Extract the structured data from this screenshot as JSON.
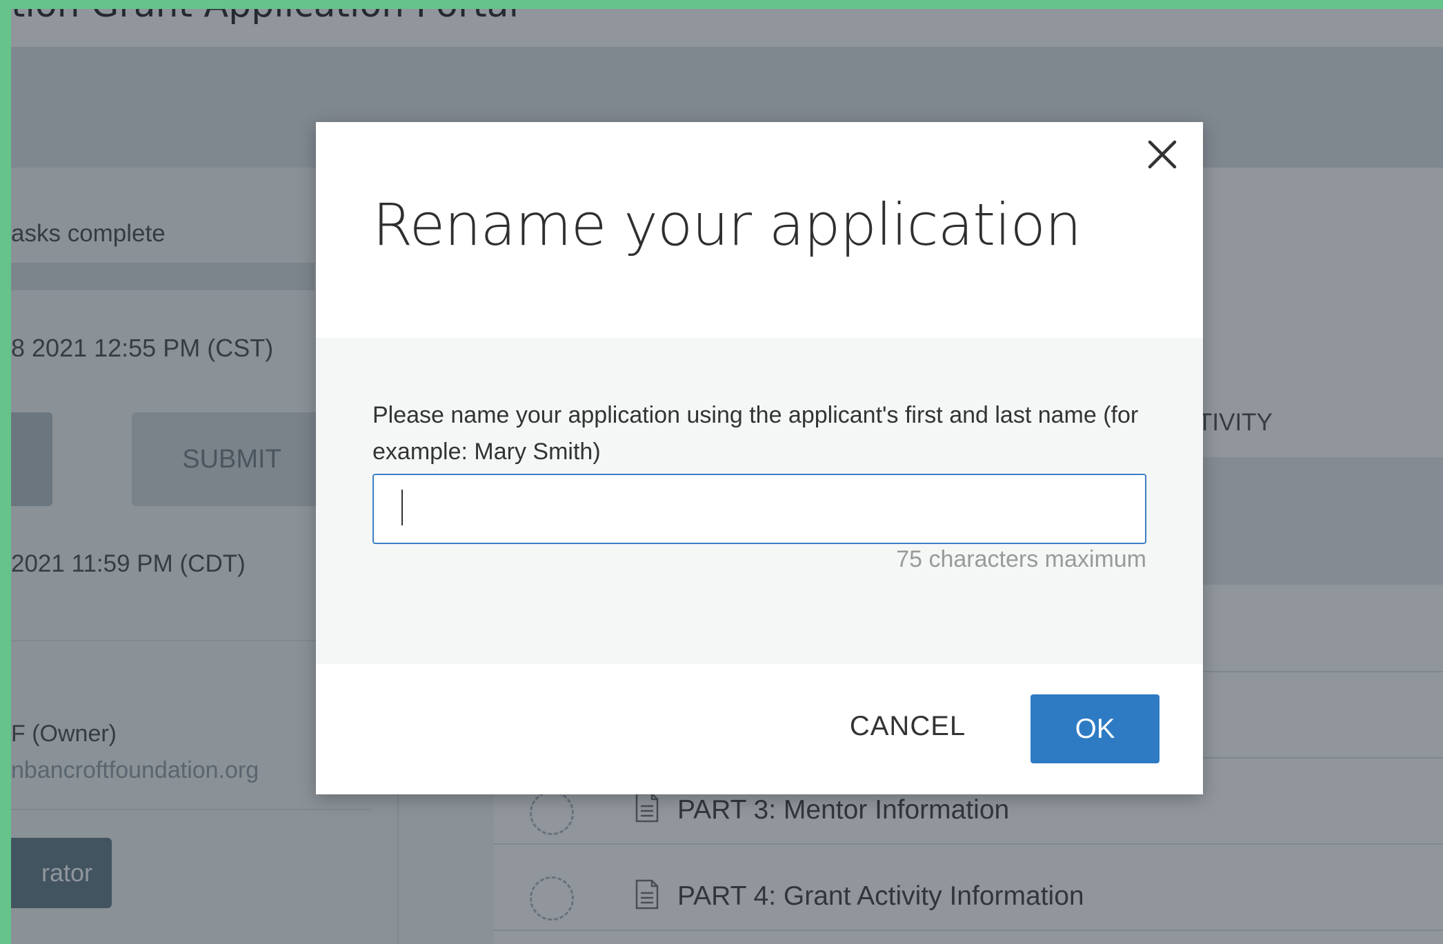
{
  "background": {
    "portal_title": "tion Grant Application Portal",
    "tasks_text": "asks complete",
    "date_started": "8 2021 12:55 PM (CST)",
    "submit_label": "SUBMIT",
    "date_deadline": "2021 11:59 PM (CDT)",
    "owner_text": "F (Owner)",
    "email_text": "nbancroftfoundation.org",
    "admin_button_label": "rator",
    "activity_text": "TIVITY",
    "tasks": [
      {
        "label": "PART 3: Mentor Information"
      },
      {
        "label": "PART 4: Grant Activity Information"
      }
    ]
  },
  "modal": {
    "title": "Rename your application",
    "instruction": "Please name your application using the applicant's first and last name (for example: Mary Smith)",
    "input_value": "",
    "input_placeholder": "",
    "char_limit": "75 characters maximum",
    "cancel_label": "CANCEL",
    "ok_label": "OK"
  },
  "colors": {
    "primary": "#2e7bc4",
    "frame": "#66c38a"
  },
  "icons": {
    "close": "close-icon",
    "task": "document-icon",
    "status": "dashed-circle-icon"
  }
}
